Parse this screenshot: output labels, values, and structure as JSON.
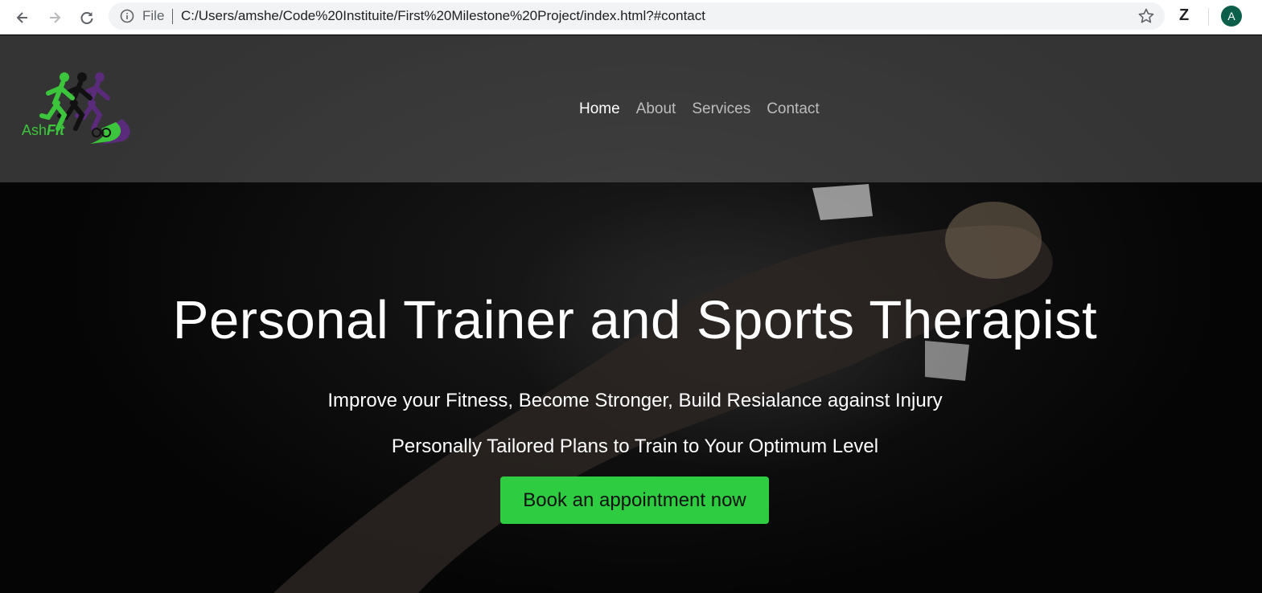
{
  "browser": {
    "scheme_label": "File",
    "url": "C:/Users/amshe/Code%20Instituite/First%20Milestone%20Project/index.html?#contact",
    "extension_label": "Z",
    "profile_initial": "A",
    "icons": [
      "back-icon",
      "forward-icon",
      "reload-icon",
      "info-icon",
      "star-icon"
    ]
  },
  "header": {
    "logo": {
      "text_regular": "Ash",
      "text_bold": "Fit",
      "colors": {
        "green": "#3cc43c",
        "purple": "#5a2b7a"
      }
    },
    "nav": [
      {
        "label": "Home",
        "active": true
      },
      {
        "label": "About",
        "active": false
      },
      {
        "label": "Services",
        "active": false
      },
      {
        "label": "Contact",
        "active": false
      }
    ]
  },
  "hero": {
    "title": "Personal Trainer and Sports Therapist",
    "tagline_1": "Improve your Fitness, Become Stronger, Build Resialance against Injury",
    "tagline_2": "Personally Tailored Plans to Train to Your Optimum Level",
    "cta_label": "Book an appointment now",
    "cta_color": "#2ecc40"
  }
}
